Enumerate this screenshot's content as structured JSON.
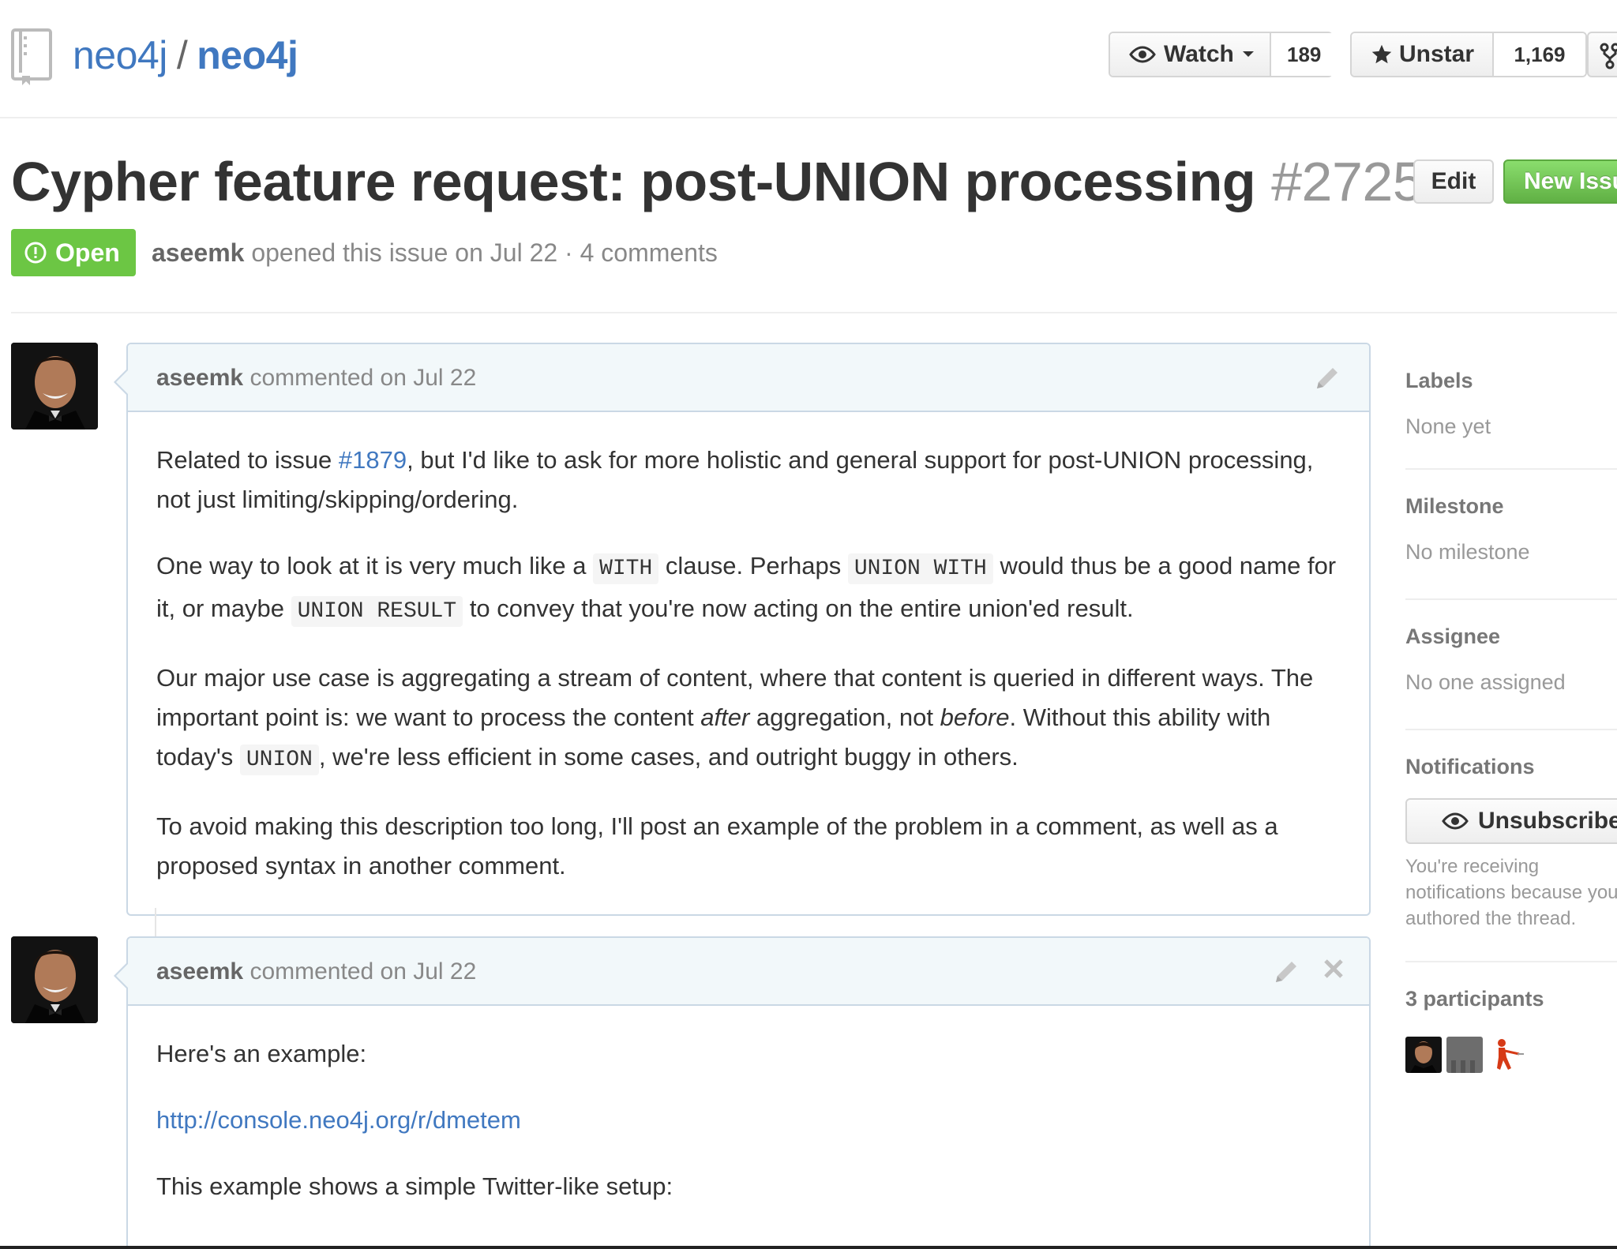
{
  "repo": {
    "owner": "neo4j",
    "separator": "/",
    "name": "neo4j"
  },
  "actions": {
    "watch_label": "Watch",
    "watch_count": "189",
    "unstar_label": "Unstar",
    "star_count": "1,169"
  },
  "issue": {
    "title": "Cypher feature request: post-UNION processing",
    "number": "#2725",
    "edit_label": "Edit",
    "new_issue_label": "New Issue",
    "state": "Open",
    "author": "aseemk",
    "opened_text": "opened this issue on Jul 22 · 4 comments"
  },
  "comments": [
    {
      "author": "aseemk",
      "action": "commented",
      "date": "on Jul 22",
      "p1": {
        "a": "Related to issue ",
        "link": "#1879",
        "b": ", but I'd like to ask for more holistic and general support for post-UNION processing, not just limiting/skipping/ordering."
      },
      "p2": {
        "a": "One way to look at it is very much like a ",
        "code1": "WITH",
        "b": " clause. Perhaps ",
        "code2": "UNION WITH",
        "c": " would thus be a good name for it, or maybe ",
        "code3": "UNION RESULT",
        "d": " to convey that you're now acting on the entire union'ed result."
      },
      "p3": {
        "a": "Our major use case is aggregating a stream of content, where that content is queried in different ways. The important point is: we want to process the content ",
        "em1": "after",
        "b": " aggregation, not ",
        "em2": "before",
        "c": ". Without this ability with today's ",
        "code1": "UNION",
        "d": ", we're less efficient in some cases, and outright buggy in others."
      },
      "p4": "To avoid making this description too long, I'll post an example of the problem in a comment, as well as a proposed syntax in another comment."
    },
    {
      "author": "aseemk",
      "action": "commented",
      "date": "on Jul 22",
      "p1": "Here's an example:",
      "link": "http://console.neo4j.org/r/dmetem",
      "p3": "This example shows a simple Twitter-like setup:"
    }
  ],
  "sidebar": {
    "labels_heading": "Labels",
    "labels_value": "None yet",
    "milestone_heading": "Milestone",
    "milestone_value": "No milestone",
    "assignee_heading": "Assignee",
    "assignee_value": "No one assigned",
    "notifications_heading": "Notifications",
    "unsubscribe_label": "Unsubscribe",
    "notification_reason": "You're receiving notifications because you authored the thread.",
    "participants_heading": "3 participants"
  },
  "colors": {
    "link": "#4078c0",
    "open_green": "#6cc644",
    "comment_border": "#cad8e5",
    "comment_header_bg": "#f2f8fa"
  },
  "icons": [
    "repo-icon",
    "eye-icon",
    "caret-down-icon",
    "star-icon",
    "fork-icon",
    "issue-opened-icon",
    "pencil-icon",
    "close-icon"
  ]
}
